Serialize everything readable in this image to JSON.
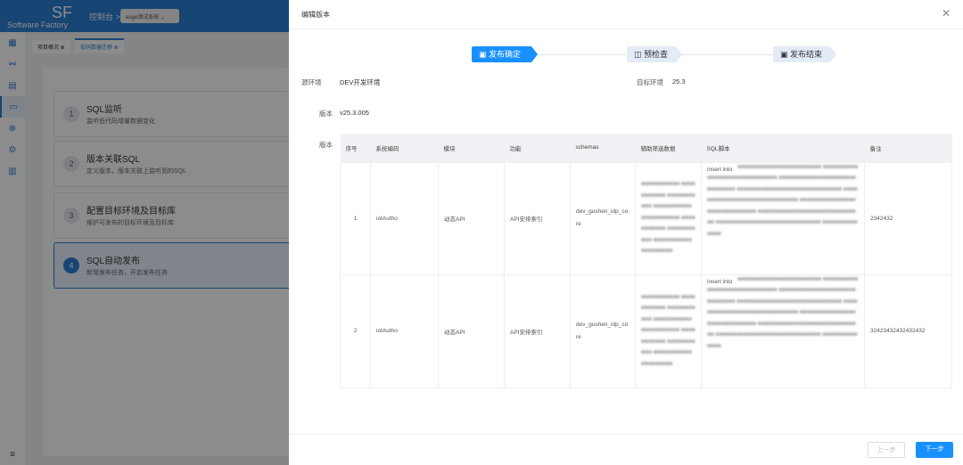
{
  "app": {
    "logo": "SF",
    "logo_sub": "Software Factory",
    "crumb": "控制台 >",
    "system_select": "eoge测试系统"
  },
  "tabs": [
    "项目概况",
    "低码数据迁移"
  ],
  "cards": [
    {
      "num": "1",
      "title": "SQL监听",
      "desc": "监听低代码增量数据变化"
    },
    {
      "num": "2",
      "title": "版本关联SQL",
      "desc": "定义版本，版本关联上监听到的SQL"
    },
    {
      "num": "3",
      "title": "配置目标环境及目标库",
      "desc": "维护可发布的目标环境及目标库"
    },
    {
      "num": "4",
      "title": "SQL自动发布",
      "desc": "新增发布任务，开启发布任务"
    }
  ],
  "drawer": {
    "title": "编辑版本",
    "steps": [
      "发布确定",
      "预检查",
      "发布结束"
    ],
    "source_env_label": "源环境",
    "source_env": "DEV开发环境",
    "target_env_label": "目标环境",
    "target_env": "25.3",
    "version_label": "版本",
    "version": "v25.3.005",
    "table_label": "版本",
    "columns": [
      "序号",
      "系统编码",
      "模块",
      "功能",
      "schemas",
      "辅助筛选数据",
      "SQL脚本",
      "备注"
    ],
    "rows": [
      {
        "no": "1",
        "code": "iotAutho",
        "module": "动态API",
        "func": "API安排索引",
        "schema": "dev_gushen_idp_core",
        "sql": "insert into",
        "remark": "2342432"
      },
      {
        "no": "2",
        "code": "iotAutho",
        "module": "动态API",
        "func": "API安排索引",
        "schema": "dev_gushen_idp_core",
        "sql": "insert into",
        "remark": "32423432432432432"
      }
    ],
    "prev": "上一步",
    "next": "下一步"
  },
  "colors": {
    "primary": "#1890ff",
    "header": "#2a7fd4"
  }
}
